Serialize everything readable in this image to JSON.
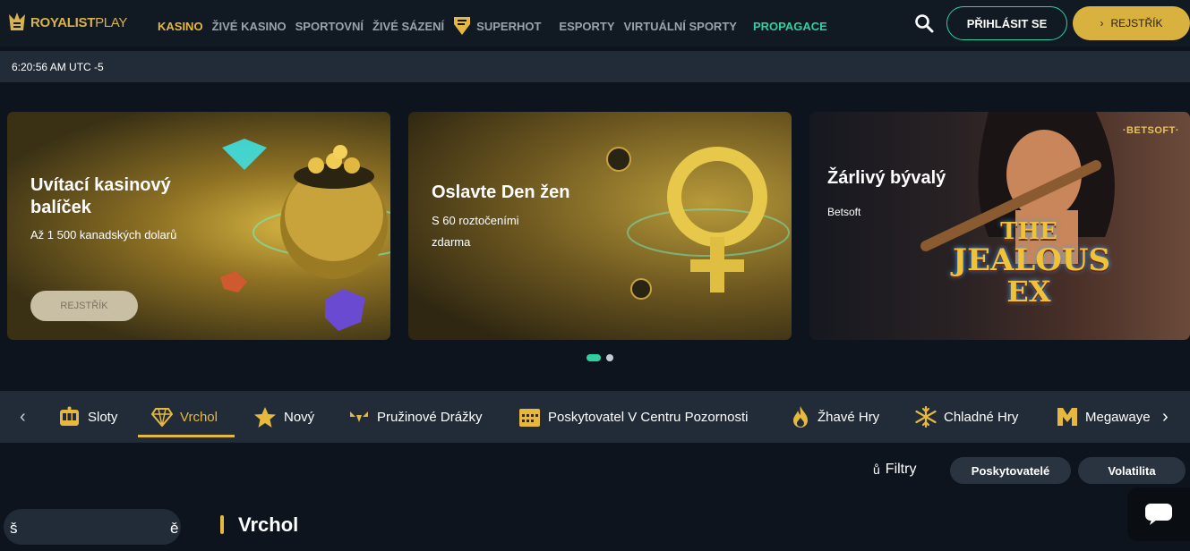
{
  "brand": {
    "name_bold": "ROYALIST",
    "name_light": "PLAY"
  },
  "nav": {
    "items": [
      "KASINO",
      "ŽIVÉ KASINO",
      "SPORTOVNÍ",
      "ŽIVÉ SÁZENÍ",
      "SUPERHOT",
      "ESPORTY",
      "VIRTUÁLNÍ SPORTY"
    ],
    "promo": "PROPAGACE",
    "active": "KASINO"
  },
  "header": {
    "login_label": "PŘIHLÁSIT SE",
    "register_label": "REJSTŘÍK"
  },
  "clock": "6:20:56 AM UTC -5",
  "banners": [
    {
      "title": "Uvítací kasinový balíček",
      "subtitle": "Až 1 500 kanadských dolarů",
      "button": "REJSTŘÍK"
    },
    {
      "title": "Oslavte Den žen",
      "subtitle": "S 60 roztočeními zdarma"
    },
    {
      "title": "Žárlivý bývalý",
      "subtitle": "Betsoft",
      "provider_badge": "·BETSOFT·",
      "art_lines": [
        "THE",
        "JEALOUS",
        "EX"
      ]
    }
  ],
  "carousel": {
    "total": 2,
    "active_index": 0
  },
  "categories": [
    {
      "label": "Sloty",
      "icon": "slot-machine-icon"
    },
    {
      "label": "Vrchol",
      "icon": "diamond-icon",
      "active": true
    },
    {
      "label": "Nový",
      "icon": "star-icon"
    },
    {
      "label": "Pružinové Drážky",
      "icon": "spring-icon"
    },
    {
      "label": "Poskytovatel V Centru Pozornosti",
      "icon": "calendar-icon"
    },
    {
      "label": "Žhavé Hry",
      "icon": "flame-icon"
    },
    {
      "label": "Chladné Hry",
      "icon": "snowflake-icon"
    },
    {
      "label": "Megawaye",
      "icon": "megaways-icon"
    }
  ],
  "filters": {
    "label": "Filtry",
    "icon_glyph": "ů",
    "providers": "Poskytovatelé",
    "volatility": "Volatilita"
  },
  "search": {
    "left_glyph": "š",
    "right_glyph": "ě"
  },
  "section": {
    "title": "Vrchol"
  },
  "colors": {
    "accent_gold": "#e7b83f",
    "accent_teal": "#2fd0a0",
    "bg": "#0d141d",
    "panel": "#222c38"
  }
}
